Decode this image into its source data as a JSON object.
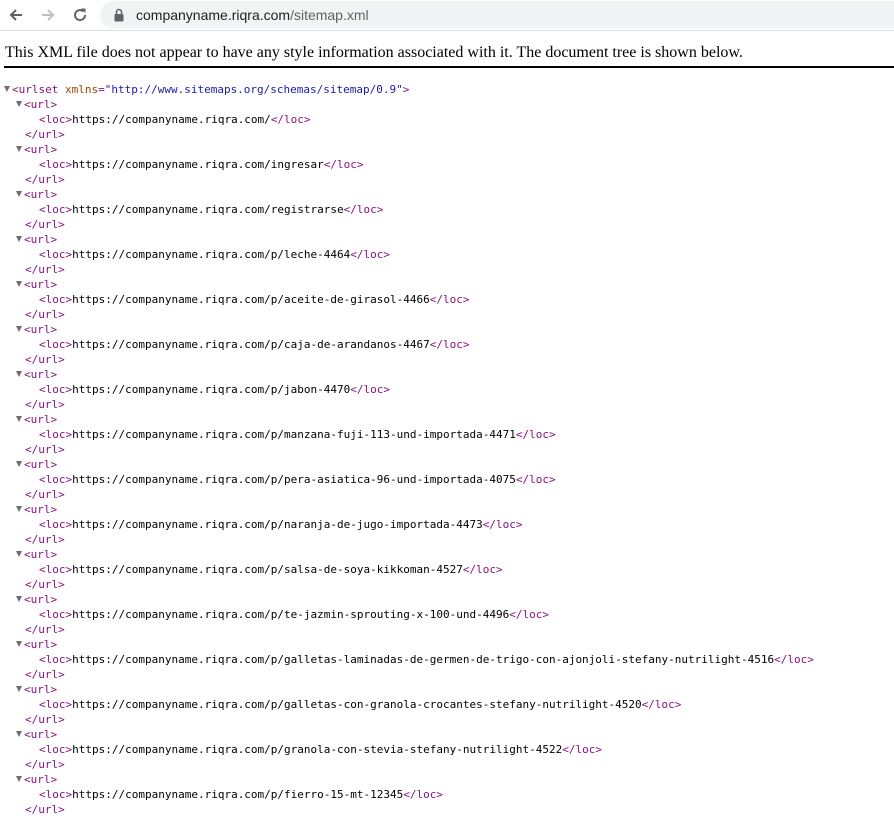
{
  "browser": {
    "url_host": "companyname.riqra.com",
    "url_path": "/sitemap.xml",
    "back_icon": "arrow-left-icon",
    "forward_icon": "arrow-right-icon",
    "reload_icon": "reload-icon",
    "lock_icon": "lock-icon"
  },
  "info_message": "This XML file does not appear to have any style information associated with it. The document tree is shown below.",
  "xml": {
    "root_tag": "urlset",
    "root_attr_name": "xmlns",
    "root_attr_value": "\"http://www.sitemaps.org/schemas/sitemap/0.9\"",
    "url_open": "<url>",
    "url_close": "</url>",
    "loc_open": "<loc>",
    "loc_close": "</loc>",
    "urls": [
      "https://companyname.riqra.com/",
      "https://companyname.riqra.com/ingresar",
      "https://companyname.riqra.com/registrarse",
      "https://companyname.riqra.com/p/leche-4464",
      "https://companyname.riqra.com/p/aceite-de-girasol-4466",
      "https://companyname.riqra.com/p/caja-de-arandanos-4467",
      "https://companyname.riqra.com/p/jabon-4470",
      "https://companyname.riqra.com/p/manzana-fuji-113-und-importada-4471",
      "https://companyname.riqra.com/p/pera-asiatica-96-und-importada-4075",
      "https://companyname.riqra.com/p/naranja-de-jugo-importada-4473",
      "https://companyname.riqra.com/p/salsa-de-soya-kikkoman-4527",
      "https://companyname.riqra.com/p/te-jazmin-sprouting-x-100-und-4496",
      "https://companyname.riqra.com/p/galletas-laminadas-de-germen-de-trigo-con-ajonjoli-stefany-nutrilight-4516",
      "https://companyname.riqra.com/p/galletas-con-granola-crocantes-stefany-nutrilight-4520",
      "https://companyname.riqra.com/p/granola-con-stevia-stefany-nutrilight-4522",
      "https://companyname.riqra.com/p/fierro-15-mt-12345"
    ]
  }
}
